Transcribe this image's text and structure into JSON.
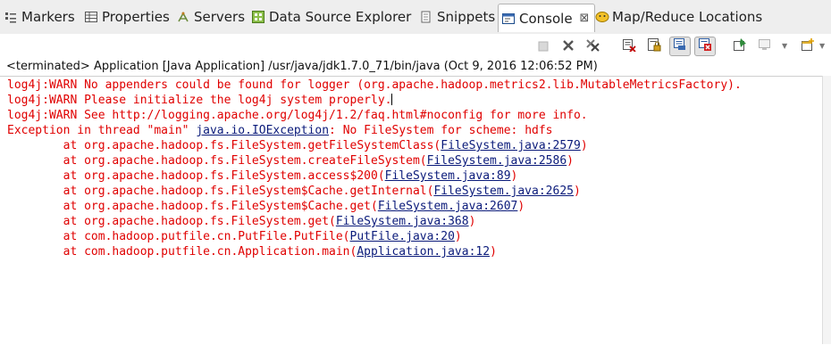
{
  "tabs": [
    {
      "label": "Markers",
      "icon": "markers-icon"
    },
    {
      "label": "Properties",
      "icon": "properties-icon"
    },
    {
      "label": "Servers",
      "icon": "servers-icon"
    },
    {
      "label": "Data Source Explorer",
      "icon": "data-source-explorer-icon"
    },
    {
      "label": "Snippets",
      "icon": "snippets-icon"
    },
    {
      "label": "Console",
      "icon": "console-icon",
      "active": true,
      "close": "⊠"
    },
    {
      "label": "Map/Reduce Locations",
      "icon": "map-reduce-locations-icon"
    }
  ],
  "status_line": "<terminated> Application [Java Application] /usr/java/jdk1.7.0_71/bin/java (Oct 9, 2016 12:06:52 PM)",
  "console": {
    "warn1": "log4j:WARN No appenders could be found for logger (org.apache.hadoop.metrics2.lib.MutableMetricsFactory).",
    "warn2": "log4j:WARN Please initialize the log4j system properly.",
    "warn3": "log4j:WARN See http://logging.apache.org/log4j/1.2/faq.html#noconfig for more info.",
    "exception": {
      "prefix": "Exception in thread \"main\" ",
      "link": "java.io.IOException",
      "suffix": ": No FileSystem for scheme: hdfs"
    },
    "stack": [
      {
        "prefix": "        at org.apache.hadoop.fs.FileSystem.getFileSystemClass(",
        "link": "FileSystem.java:2579",
        "suffix": ")"
      },
      {
        "prefix": "        at org.apache.hadoop.fs.FileSystem.createFileSystem(",
        "link": "FileSystem.java:2586",
        "suffix": ")"
      },
      {
        "prefix": "        at org.apache.hadoop.fs.FileSystem.access$200(",
        "link": "FileSystem.java:89",
        "suffix": ")"
      },
      {
        "prefix": "        at org.apache.hadoop.fs.FileSystem$Cache.getInternal(",
        "link": "FileSystem.java:2625",
        "suffix": ")"
      },
      {
        "prefix": "        at org.apache.hadoop.fs.FileSystem$Cache.get(",
        "link": "FileSystem.java:2607",
        "suffix": ")"
      },
      {
        "prefix": "        at org.apache.hadoop.fs.FileSystem.get(",
        "link": "FileSystem.java:368",
        "suffix": ")"
      },
      {
        "prefix": "        at com.hadoop.putfile.cn.PutFile.PutFile(",
        "link": "PutFile.java:20",
        "suffix": ")"
      },
      {
        "prefix": "        at com.hadoop.putfile.cn.Application.main(",
        "link": "Application.java:12",
        "suffix": ")"
      }
    ]
  },
  "toolbar": [
    {
      "name": "terminate-icon",
      "enabled": false
    },
    {
      "name": "remove-launch-icon",
      "enabled": true
    },
    {
      "name": "remove-all-terminated-icon",
      "enabled": true
    },
    {
      "name": "clear-console-icon",
      "enabled": true
    },
    {
      "name": "scroll-lock-icon",
      "enabled": true
    },
    {
      "name": "show-console-on-stdout-icon",
      "pressed": true
    },
    {
      "name": "show-console-on-stderr-icon",
      "pressed": true
    },
    {
      "name": "pin-console-icon",
      "enabled": true
    },
    {
      "name": "display-selected-console-icon",
      "enabled": false
    },
    {
      "name": "open-console-icon",
      "enabled": true
    }
  ],
  "colors": {
    "error": "#e00000",
    "link": "#0a1a7a",
    "tabbar": "#eeeeee"
  }
}
